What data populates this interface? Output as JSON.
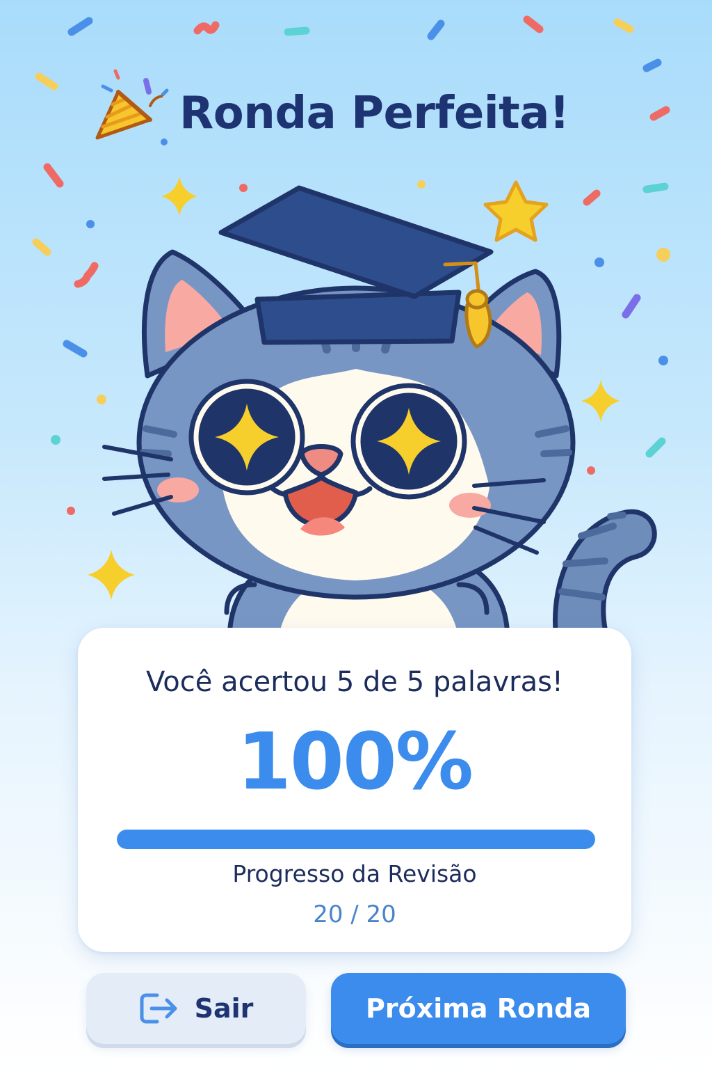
{
  "title": {
    "text": "Ronda Perfeita!",
    "icon": "party-popper-icon"
  },
  "mascot": {
    "name": "graduate-cat",
    "icon": "cat-with-graduation-cap"
  },
  "result": {
    "message": "Você acertou 5 de 5 palavras!",
    "percent_label": "100%",
    "correct": 5,
    "total": 5
  },
  "review": {
    "label": "Progresso da Revisão",
    "count_label": "20 / 20",
    "progress_fraction": 1.0
  },
  "buttons": {
    "exit_label": "Sair",
    "exit_icon": "exit-icon",
    "next_label": "Próxima Ronda"
  },
  "colors": {
    "accent": "#3b8cec",
    "title": "#1e3472",
    "exit_bg": "#e4ecf8"
  }
}
